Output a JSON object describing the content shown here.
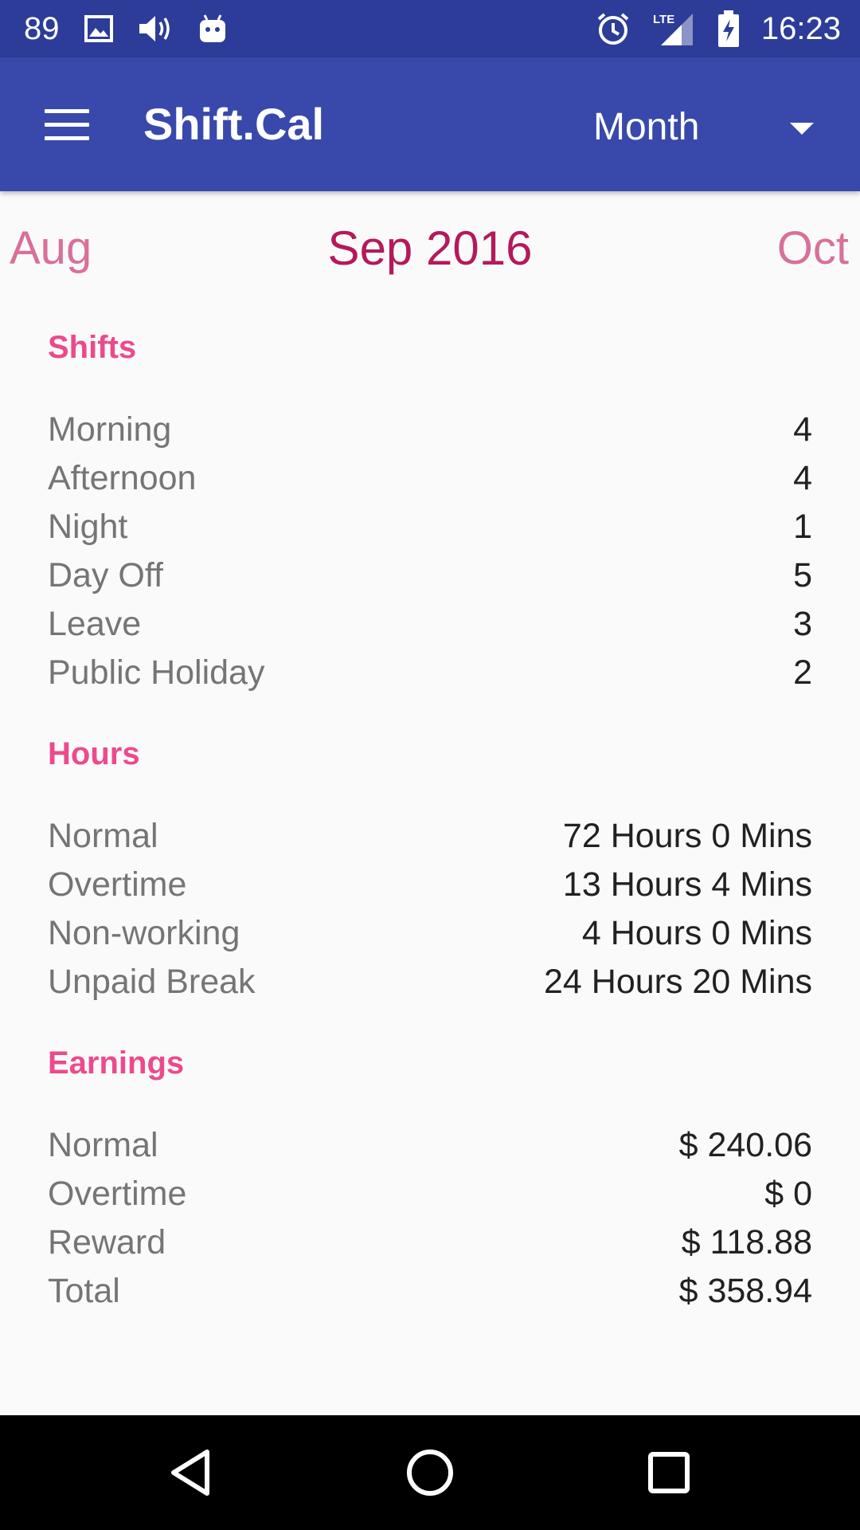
{
  "status_bar": {
    "notification_count": "89",
    "time": "16:23",
    "network": "LTE",
    "icons": [
      "image-icon",
      "volume-icon",
      "android-icon",
      "alarm-icon",
      "signal-icon",
      "battery-charging-icon"
    ]
  },
  "app_bar": {
    "title": "Shift.Cal",
    "view_mode": "Month",
    "color": "#3949ab"
  },
  "month_nav": {
    "previous": "Aug",
    "current": "Sep 2016",
    "next": "Oct"
  },
  "shifts": {
    "title": "Shifts",
    "rows": [
      {
        "label": "Morning",
        "value": "4"
      },
      {
        "label": "Afternoon",
        "value": "4"
      },
      {
        "label": "Night",
        "value": "1"
      },
      {
        "label": "Day Off",
        "value": "5"
      },
      {
        "label": "Leave",
        "value": "3"
      },
      {
        "label": "Public Holiday",
        "value": "2"
      }
    ]
  },
  "hours": {
    "title": "Hours",
    "rows": [
      {
        "label": "Normal",
        "value": "72 Hours 0 Mins"
      },
      {
        "label": "Overtime",
        "value": "13 Hours 4 Mins"
      },
      {
        "label": "Non-working",
        "value": "4 Hours 0 Mins"
      },
      {
        "label": "Unpaid Break",
        "value": "24 Hours 20 Mins"
      }
    ]
  },
  "earnings": {
    "title": "Earnings",
    "rows": [
      {
        "label": "Normal",
        "value": "$ 240.06"
      },
      {
        "label": "Overtime",
        "value": "$ 0"
      },
      {
        "label": "Reward",
        "value": "$ 118.88"
      },
      {
        "label": "Total",
        "value": "$ 358.94"
      }
    ]
  },
  "colors": {
    "status_bar": "#2c3c98",
    "section_title": "#ec4a8c",
    "current_month": "#b5195a",
    "adjacent_month": "#d9709a"
  }
}
